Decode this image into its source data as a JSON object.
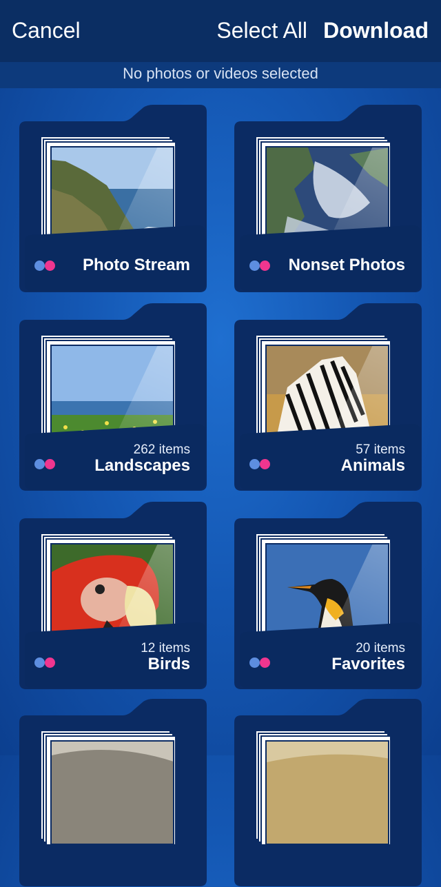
{
  "topbar": {
    "cancel_label": "Cancel",
    "select_all_label": "Select All",
    "download_label": "Download"
  },
  "status": {
    "text": "No photos or videos selected"
  },
  "colors": {
    "topbar": "#0b2e63",
    "background": "#1457b3",
    "folder": "#0b2b63",
    "dot_blue": "#5d8ee0",
    "dot_pink": "#f0368f"
  },
  "albums": [
    {
      "name": "Photo Stream",
      "count": "",
      "photo": "coastline"
    },
    {
      "name": "Nonset Photos",
      "count": "",
      "photo": "earth"
    },
    {
      "name": "Landscapes",
      "count": "262 items",
      "photo": "seaside-meadow"
    },
    {
      "name": "Animals",
      "count": "57 items",
      "photo": "zebra"
    },
    {
      "name": "Birds",
      "count": "12 items",
      "photo": "parrot"
    },
    {
      "name": "Favorites",
      "count": "20 items",
      "photo": "penguin"
    },
    {
      "name": "",
      "count": "",
      "photo": "partial"
    },
    {
      "name": "",
      "count": "",
      "photo": "partial"
    }
  ]
}
